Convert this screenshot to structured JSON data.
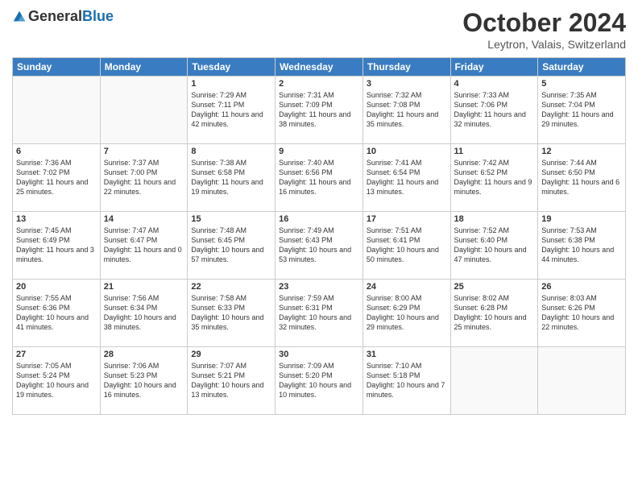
{
  "header": {
    "logo_general": "General",
    "logo_blue": "Blue",
    "month_title": "October 2024",
    "location": "Leytron, Valais, Switzerland"
  },
  "days_of_week": [
    "Sunday",
    "Monday",
    "Tuesday",
    "Wednesday",
    "Thursday",
    "Friday",
    "Saturday"
  ],
  "weeks": [
    [
      {
        "day": "",
        "info": ""
      },
      {
        "day": "",
        "info": ""
      },
      {
        "day": "1",
        "info": "Sunrise: 7:29 AM\nSunset: 7:11 PM\nDaylight: 11 hours and 42 minutes."
      },
      {
        "day": "2",
        "info": "Sunrise: 7:31 AM\nSunset: 7:09 PM\nDaylight: 11 hours and 38 minutes."
      },
      {
        "day": "3",
        "info": "Sunrise: 7:32 AM\nSunset: 7:08 PM\nDaylight: 11 hours and 35 minutes."
      },
      {
        "day": "4",
        "info": "Sunrise: 7:33 AM\nSunset: 7:06 PM\nDaylight: 11 hours and 32 minutes."
      },
      {
        "day": "5",
        "info": "Sunrise: 7:35 AM\nSunset: 7:04 PM\nDaylight: 11 hours and 29 minutes."
      }
    ],
    [
      {
        "day": "6",
        "info": "Sunrise: 7:36 AM\nSunset: 7:02 PM\nDaylight: 11 hours and 25 minutes."
      },
      {
        "day": "7",
        "info": "Sunrise: 7:37 AM\nSunset: 7:00 PM\nDaylight: 11 hours and 22 minutes."
      },
      {
        "day": "8",
        "info": "Sunrise: 7:38 AM\nSunset: 6:58 PM\nDaylight: 11 hours and 19 minutes."
      },
      {
        "day": "9",
        "info": "Sunrise: 7:40 AM\nSunset: 6:56 PM\nDaylight: 11 hours and 16 minutes."
      },
      {
        "day": "10",
        "info": "Sunrise: 7:41 AM\nSunset: 6:54 PM\nDaylight: 11 hours and 13 minutes."
      },
      {
        "day": "11",
        "info": "Sunrise: 7:42 AM\nSunset: 6:52 PM\nDaylight: 11 hours and 9 minutes."
      },
      {
        "day": "12",
        "info": "Sunrise: 7:44 AM\nSunset: 6:50 PM\nDaylight: 11 hours and 6 minutes."
      }
    ],
    [
      {
        "day": "13",
        "info": "Sunrise: 7:45 AM\nSunset: 6:49 PM\nDaylight: 11 hours and 3 minutes."
      },
      {
        "day": "14",
        "info": "Sunrise: 7:47 AM\nSunset: 6:47 PM\nDaylight: 11 hours and 0 minutes."
      },
      {
        "day": "15",
        "info": "Sunrise: 7:48 AM\nSunset: 6:45 PM\nDaylight: 10 hours and 57 minutes."
      },
      {
        "day": "16",
        "info": "Sunrise: 7:49 AM\nSunset: 6:43 PM\nDaylight: 10 hours and 53 minutes."
      },
      {
        "day": "17",
        "info": "Sunrise: 7:51 AM\nSunset: 6:41 PM\nDaylight: 10 hours and 50 minutes."
      },
      {
        "day": "18",
        "info": "Sunrise: 7:52 AM\nSunset: 6:40 PM\nDaylight: 10 hours and 47 minutes."
      },
      {
        "day": "19",
        "info": "Sunrise: 7:53 AM\nSunset: 6:38 PM\nDaylight: 10 hours and 44 minutes."
      }
    ],
    [
      {
        "day": "20",
        "info": "Sunrise: 7:55 AM\nSunset: 6:36 PM\nDaylight: 10 hours and 41 minutes."
      },
      {
        "day": "21",
        "info": "Sunrise: 7:56 AM\nSunset: 6:34 PM\nDaylight: 10 hours and 38 minutes."
      },
      {
        "day": "22",
        "info": "Sunrise: 7:58 AM\nSunset: 6:33 PM\nDaylight: 10 hours and 35 minutes."
      },
      {
        "day": "23",
        "info": "Sunrise: 7:59 AM\nSunset: 6:31 PM\nDaylight: 10 hours and 32 minutes."
      },
      {
        "day": "24",
        "info": "Sunrise: 8:00 AM\nSunset: 6:29 PM\nDaylight: 10 hours and 29 minutes."
      },
      {
        "day": "25",
        "info": "Sunrise: 8:02 AM\nSunset: 6:28 PM\nDaylight: 10 hours and 25 minutes."
      },
      {
        "day": "26",
        "info": "Sunrise: 8:03 AM\nSunset: 6:26 PM\nDaylight: 10 hours and 22 minutes."
      }
    ],
    [
      {
        "day": "27",
        "info": "Sunrise: 7:05 AM\nSunset: 5:24 PM\nDaylight: 10 hours and 19 minutes."
      },
      {
        "day": "28",
        "info": "Sunrise: 7:06 AM\nSunset: 5:23 PM\nDaylight: 10 hours and 16 minutes."
      },
      {
        "day": "29",
        "info": "Sunrise: 7:07 AM\nSunset: 5:21 PM\nDaylight: 10 hours and 13 minutes."
      },
      {
        "day": "30",
        "info": "Sunrise: 7:09 AM\nSunset: 5:20 PM\nDaylight: 10 hours and 10 minutes."
      },
      {
        "day": "31",
        "info": "Sunrise: 7:10 AM\nSunset: 5:18 PM\nDaylight: 10 hours and 7 minutes."
      },
      {
        "day": "",
        "info": ""
      },
      {
        "day": "",
        "info": ""
      }
    ]
  ]
}
